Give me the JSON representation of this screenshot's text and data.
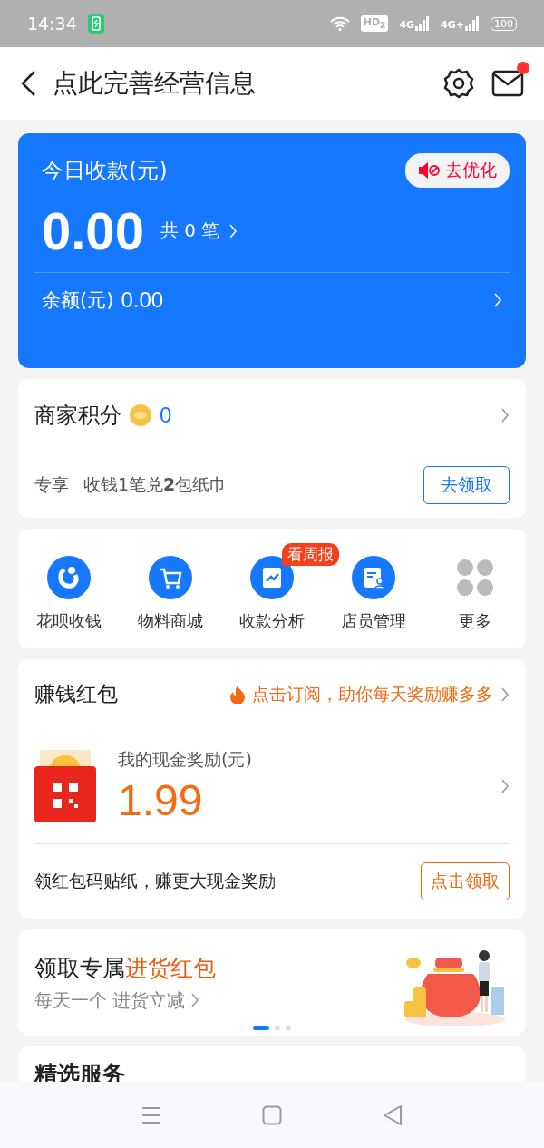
{
  "status_bar": {
    "time": "14:34",
    "hd": "HD$_{2}$",
    "networks": [
      "4G",
      "4G+"
    ],
    "battery": "100"
  },
  "header": {
    "title": "点此完善经营信息",
    "has_unread": true
  },
  "today": {
    "title": "今日收款(元)",
    "optimize": "去优化",
    "amount": "0.00",
    "count": "共 0 笔",
    "balance_label": "余额(元)",
    "balance": "0.00"
  },
  "points": {
    "title": "商家积分",
    "value": "0",
    "perk_label": "专享",
    "perk_text": "收钱1笔兑**2**包纸巾",
    "perk_button": "去领取"
  },
  "shortcuts": [
    {
      "label": "花呗收钱",
      "kind": "huabei"
    },
    {
      "label": "物料商城",
      "kind": "cart"
    },
    {
      "label": "收款分析",
      "kind": "chart",
      "badge": "看周报"
    },
    {
      "label": "店员管理",
      "kind": "staff"
    },
    {
      "label": "更多",
      "kind": "more"
    }
  ],
  "red_packet": {
    "title": "赚钱红包",
    "subscribe": "点击订阅，助你每天奖励赚多多",
    "reward_label": "我的现金奖励(元)",
    "reward": "1.99",
    "sticker_text": "领红包码贴纸，赚更大现金奖励",
    "sticker_button": "点击领取"
  },
  "banner": {
    "title": "领取专属",
    "highlight": "进货红包",
    "subtitle": "每天一个 进货立减",
    "pages": [
      {
        "selected": true
      },
      {
        "selected": false
      },
      {
        "selected": false
      }
    ]
  },
  "services": {
    "title": "精选服务"
  }
}
